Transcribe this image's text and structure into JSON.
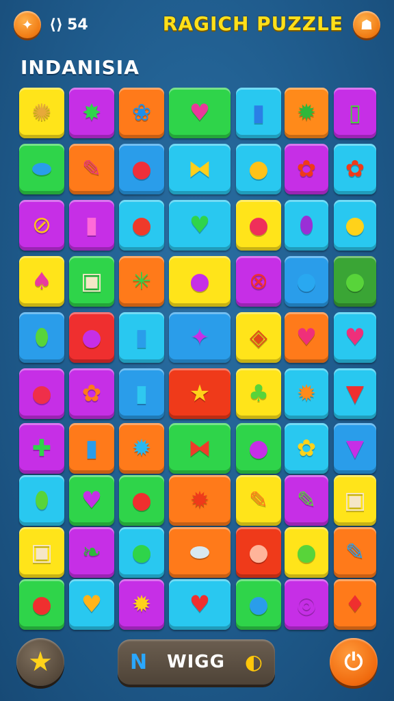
{
  "header": {
    "counter_icon": "loop-icon",
    "counter_value": "54",
    "title": "RAGICH PUZZLE",
    "back_icon": "back-icon",
    "profile_icon": "profile-icon"
  },
  "level_name": "INDANISIA",
  "board": {
    "rows": [
      [
        {
          "c": "#ffe41a",
          "i": "✺",
          "n": "gear-icon"
        },
        {
          "c": "#c62fe6",
          "i": "✸",
          "n": "star-face-icon"
        },
        {
          "c": "#ff7a1a",
          "i": "❀",
          "n": "blue-flower-icon"
        },
        {
          "c": "#2fd44a",
          "i": "♥",
          "n": "heart-bow-icon"
        },
        {
          "c": "#29c8f0",
          "i": "▮",
          "n": "blue-cup-icon"
        },
        {
          "c": "#ff8a1a",
          "i": "✹",
          "n": "green-sun-icon"
        },
        {
          "c": "#c62fe6",
          "i": "▯",
          "n": "green-bottle-icon"
        }
      ],
      [
        {
          "c": "#2fd44a",
          "i": "⬬",
          "n": "pill-icon"
        },
        {
          "c": "#ff7a1a",
          "i": "✎",
          "n": "crayon-icon"
        },
        {
          "c": "#2a9dea",
          "i": "●",
          "n": "apple-icon"
        },
        {
          "c": "#29c8f0",
          "i": "⧓",
          "n": "bow-icon"
        },
        {
          "c": "#29c8f0",
          "i": "●",
          "n": "smiley-icon"
        },
        {
          "c": "#c62fe6",
          "i": "✿",
          "n": "red-flower-icon"
        },
        {
          "c": "#29c8f0",
          "i": "✿",
          "n": "red-flower-icon"
        }
      ],
      [
        {
          "c": "#c62fe6",
          "i": "⊘",
          "n": "ball-icon"
        },
        {
          "c": "#c62fe6",
          "i": "▮",
          "n": "pink-cup-icon"
        },
        {
          "c": "#29c8f0",
          "i": "●",
          "n": "red-face-icon"
        },
        {
          "c": "#29c8f0",
          "i": "♥",
          "n": "green-heart-icon"
        },
        {
          "c": "#ffe41a",
          "i": "●",
          "n": "strawberry-icon"
        },
        {
          "c": "#29c8f0",
          "i": "⬮",
          "n": "eggplant-icon"
        },
        {
          "c": "#29c8f0",
          "i": "●",
          "n": "lemon-face-icon"
        }
      ],
      [
        {
          "c": "#ffe41a",
          "i": "♠",
          "n": "candy-icon"
        },
        {
          "c": "#2fd44a",
          "i": "▣",
          "n": "toast-icon"
        },
        {
          "c": "#ff7a1a",
          "i": "✳",
          "n": "wand-icon"
        },
        {
          "c": "#ffe41a",
          "i": "●",
          "n": "plum-icon"
        },
        {
          "c": "#c62fe6",
          "i": "⊗",
          "n": "no-sign-icon"
        },
        {
          "c": "#2a9dea",
          "i": "●",
          "n": "blue-apple-icon"
        },
        {
          "c": "#3aa535",
          "i": "●",
          "n": "green-apple-icon"
        }
      ],
      [
        {
          "c": "#2a9dea",
          "i": "⬮",
          "n": "pear-icon"
        },
        {
          "c": "#ef2f2f",
          "i": "●",
          "n": "purple-apple-icon"
        },
        {
          "c": "#29c8f0",
          "i": "▮",
          "n": "jar-icon"
        },
        {
          "c": "#2a9dea",
          "i": "✦",
          "n": "wrapped-candy-icon"
        },
        {
          "c": "#ffe41a",
          "i": "◈",
          "n": "eye-icon"
        },
        {
          "c": "#ff7a1a",
          "i": "♥",
          "n": "pink-heart-icon"
        },
        {
          "c": "#29c8f0",
          "i": "♥",
          "n": "pink-heart-icon"
        }
      ],
      [
        {
          "c": "#c62fe6",
          "i": "●",
          "n": "red-apple-icon"
        },
        {
          "c": "#c62fe6",
          "i": "✿",
          "n": "orange-donut-icon"
        },
        {
          "c": "#2a9dea",
          "i": "▮",
          "n": "cupcake-icon"
        },
        {
          "c": "#ef3a1a",
          "i": "★",
          "n": "shooting-star-icon"
        },
        {
          "c": "#ffe41a",
          "i": "♣",
          "n": "tree-icon"
        },
        {
          "c": "#29c8f0",
          "i": "✹",
          "n": "sun-stick-icon"
        },
        {
          "c": "#29c8f0",
          "i": "▼",
          "n": "strawberry-cone-icon"
        }
      ],
      [
        {
          "c": "#c62fe6",
          "i": "✚",
          "n": "cactus-pot-icon"
        },
        {
          "c": "#ff7a1a",
          "i": "▮",
          "n": "soda-can-icon"
        },
        {
          "c": "#ff7a1a",
          "i": "✹",
          "n": "blue-puff-icon"
        },
        {
          "c": "#2fd44a",
          "i": "⧓",
          "n": "ribbon-icon"
        },
        {
          "c": "#2fd44a",
          "i": "●",
          "n": "purple-monster-icon"
        },
        {
          "c": "#29c8f0",
          "i": "✿",
          "n": "yellow-flower-icon"
        },
        {
          "c": "#2a9dea",
          "i": "▼",
          "n": "berry-icon"
        }
      ],
      [
        {
          "c": "#29c8f0",
          "i": "⬮",
          "n": "leaf-icon"
        },
        {
          "c": "#2fd44a",
          "i": "♥",
          "n": "purple-heart-icon"
        },
        {
          "c": "#2fd44a",
          "i": "●",
          "n": "tomato-icon"
        },
        {
          "c": "#ff7a1a",
          "i": "✹",
          "n": "orange-flower-icon"
        },
        {
          "c": "#ffe41a",
          "i": "✎",
          "n": "carrot-icon"
        },
        {
          "c": "#c62fe6",
          "i": "✎",
          "n": "green-crayon-icon"
        },
        {
          "c": "#ffe41a",
          "i": "▣",
          "n": "bread-face-icon"
        }
      ],
      [
        {
          "c": "#ffe41a",
          "i": "▣",
          "n": "mushroom-icon"
        },
        {
          "c": "#c62fe6",
          "i": "❧",
          "n": "green-leaf-icon"
        },
        {
          "c": "#29c8f0",
          "i": "●",
          "n": "green-pot-icon"
        },
        {
          "c": "#ff7a1a",
          "i": "⬬",
          "n": "grey-drop-icon"
        },
        {
          "c": "#ef3a1a",
          "i": "●",
          "n": "face-icon"
        },
        {
          "c": "#ffe41a",
          "i": "●",
          "n": "green-drop-icon"
        },
        {
          "c": "#ff7a1a",
          "i": "✎",
          "n": "blue-pencil-icon"
        }
      ],
      [
        {
          "c": "#2fd44a",
          "i": "●",
          "n": "cherry-icon"
        },
        {
          "c": "#29c8f0",
          "i": "♥",
          "n": "striped-heart-icon"
        },
        {
          "c": "#c62fe6",
          "i": "✹",
          "n": "yellow-sun-icon"
        },
        {
          "c": "#29c8f0",
          "i": "♥",
          "n": "red-heart-icon"
        },
        {
          "c": "#2fd44a",
          "i": "●",
          "n": "blue-face-icon"
        },
        {
          "c": "#c62fe6",
          "i": "◎",
          "n": "donut-icon"
        },
        {
          "c": "#ff7a1a",
          "i": "♦",
          "n": "red-drop-icon"
        }
      ]
    ],
    "icon_colors": {
      "gear-icon": "#e7a93a",
      "star-face-icon": "#2fd44a",
      "blue-flower-icon": "#1e8fea",
      "heart-bow-icon": "#e93a9a",
      "blue-cup-icon": "#2a7fe6",
      "green-sun-icon": "#2fb83a",
      "green-bottle-icon": "#4ad43a",
      "pill-icon": "#2a9dea",
      "crayon-icon": "#e9377a",
      "apple-icon": "#ef2f3a",
      "bow-icon": "#ffcf1a",
      "smiley-icon": "#ffc21a",
      "red-flower-icon": "#ef3a1a",
      "ball-icon": "#ffc21a",
      "pink-cup-icon": "#ff6ad8",
      "red-face-icon": "#ef3a2a",
      "green-heart-icon": "#2fd44a",
      "strawberry-icon": "#ef2f5a",
      "eggplant-icon": "#9a2fd6",
      "lemon-face-icon": "#ffd21a",
      "candy-icon": "#e93aa0",
      "toast-icon": "#f5e6c8",
      "wand-icon": "#2fd44a",
      "plum-icon": "#c62fe6",
      "no-sign-icon": "#ef2f2f",
      "blue-apple-icon": "#29a8f0",
      "green-apple-icon": "#58d43a",
      "pear-icon": "#58d43a",
      "purple-apple-icon": "#c62fe6",
      "jar-icon": "#2a9dea",
      "wrapped-candy-icon": "#c62fe6",
      "eye-icon": "#e04a1a",
      "pink-heart-icon": "#ef2f7a",
      "red-apple-icon": "#ef2f4a",
      "orange-donut-icon": "#ff7a1a",
      "cupcake-icon": "#2fc8f0",
      "shooting-star-icon": "#ffd21a",
      "tree-icon": "#58d43a",
      "sun-stick-icon": "#ff8a1a",
      "strawberry-cone-icon": "#ef2f2f",
      "cactus-pot-icon": "#2fd44a",
      "soda-can-icon": "#2a9dea",
      "blue-puff-icon": "#29b8f0",
      "ribbon-icon": "#ef3a2a",
      "purple-monster-icon": "#c62fe6",
      "yellow-flower-icon": "#ffd21a",
      "berry-icon": "#c62fe6",
      "leaf-icon": "#58d43a",
      "purple-heart-icon": "#c62fe6",
      "tomato-icon": "#ef2f2f",
      "orange-flower-icon": "#ef3a1a",
      "carrot-icon": "#ff7a1a",
      "green-crayon-icon": "#58d43a",
      "bread-face-icon": "#f5e6c8",
      "mushroom-icon": "#f5e6c8",
      "green-leaf-icon": "#2fb83a",
      "green-pot-icon": "#2fd44a",
      "grey-drop-icon": "#d8e8f0",
      "face-icon": "#ffb49a",
      "green-drop-icon": "#58d43a",
      "blue-pencil-icon": "#2a9dea",
      "cherry-icon": "#ef2f2f",
      "striped-heart-icon": "#ffb41a",
      "yellow-sun-icon": "#ffd21a",
      "red-heart-icon": "#ef2f2f",
      "blue-face-icon": "#2a9dea",
      "donut-icon": "#c62fe6",
      "red-drop-icon": "#ef2f2f"
    }
  },
  "footer": {
    "star_icon": "star-icon",
    "mode_left_icon": "n-logo-icon",
    "mode_label": "WIGG",
    "mode_right_icon": "coin-icon",
    "power_icon": "power-icon"
  }
}
